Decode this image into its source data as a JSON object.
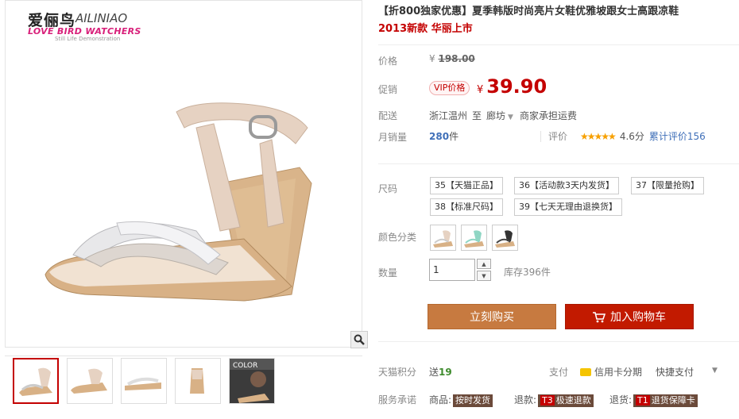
{
  "brand": {
    "name_cn": "爱俪鸟",
    "name_en": "AILINIAO",
    "slogan": "LOVE BIRD WATCHERS",
    "watermark": "Still Life Demonstration"
  },
  "product": {
    "title": "【折800独家优惠】夏季韩版时尚亮片女鞋优雅坡跟女士高跟凉鞋",
    "subtitle": "2013新款 华丽上市"
  },
  "price": {
    "label": "价格",
    "currency": "¥",
    "original": "198.00",
    "promo_label": "促销",
    "vip_badge": "VIP价格",
    "promo": "39.90"
  },
  "shipping": {
    "label": "配送",
    "from": "浙江温州",
    "to_word": "至",
    "destination": "廊坊",
    "fee_note": "商家承担运费"
  },
  "sales": {
    "label": "月销量",
    "count": "280",
    "unit": "件",
    "rating_label": "评价",
    "stars": "★★★★★",
    "score": "4.6分",
    "reviews": "累计评价156"
  },
  "sku": {
    "size_label": "尺码",
    "sizes": [
      "35【天猫正品】",
      "36【活动款3天内发货】",
      "37【限量抢购】",
      "38【标准尺码】",
      "39【七天无理由退换货】"
    ],
    "color_label": "颜色分类",
    "colors": [
      "beige-sandal",
      "mint-sandal",
      "black-sandal"
    ],
    "qty_label": "数量",
    "qty_value": "1",
    "stock": "库存396件"
  },
  "actions": {
    "buy_now": "立刻购买",
    "add_cart": "加入购物车"
  },
  "service": {
    "points_label": "天猫积分",
    "points_prefix": "送",
    "points": "19",
    "pay_label": "支付",
    "pay_credit": "信用卡分期",
    "pay_quick": "快捷支付",
    "promise_label": "服务承诺",
    "items": [
      {
        "prefix": "商品:",
        "tag": "按时发货"
      },
      {
        "prefix": "退款:",
        "icon": "T3",
        "tag": "极速退款"
      },
      {
        "prefix": "退货:",
        "icon": "T1",
        "tag": "退货保障卡"
      }
    ]
  },
  "colors": {
    "accent_red": "#c40000",
    "buy_button": "#c77a40",
    "cart_button": "#c21a00",
    "link_blue": "#3f6fb8"
  }
}
